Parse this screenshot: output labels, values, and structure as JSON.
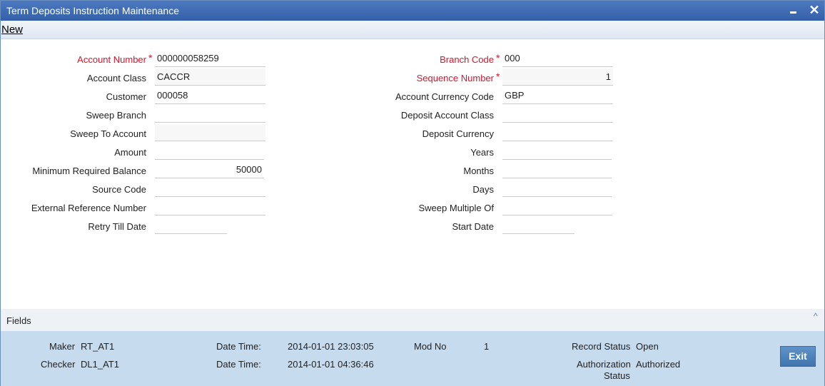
{
  "window": {
    "title": "Term Deposits Instruction Maintenance",
    "minimize": "",
    "close": "✕"
  },
  "menu": {
    "new_label": "New"
  },
  "left_form": {
    "account_number": {
      "label": "Account Number",
      "value": "000000058259"
    },
    "account_class": {
      "label": "Account Class",
      "value": "CACCR"
    },
    "customer": {
      "label": "Customer",
      "value": "000058"
    },
    "sweep_branch": {
      "label": "Sweep Branch",
      "value": ""
    },
    "sweep_to_account": {
      "label": "Sweep To Account",
      "value": ""
    },
    "amount": {
      "label": "Amount",
      "value": ""
    },
    "min_required_balance": {
      "label": "Minimum Required Balance",
      "value": "50000"
    },
    "source_code": {
      "label": "Source Code",
      "value": ""
    },
    "external_reference_number": {
      "label": "External Reference Number",
      "value": ""
    },
    "retry_till_date": {
      "label": "Retry Till Date",
      "value": ""
    }
  },
  "right_form": {
    "branch_code": {
      "label": "Branch Code",
      "value": "000"
    },
    "sequence_number": {
      "label": "Sequence Number",
      "value": "1"
    },
    "account_currency_code": {
      "label": "Account Currency Code",
      "value": "GBP"
    },
    "deposit_account_class": {
      "label": "Deposit Account Class",
      "value": ""
    },
    "deposit_currency": {
      "label": "Deposit Currency",
      "value": ""
    },
    "years": {
      "label": "Years",
      "value": ""
    },
    "months": {
      "label": "Months",
      "value": ""
    },
    "days": {
      "label": "Days",
      "value": ""
    },
    "sweep_multiple_of": {
      "label": "Sweep Multiple Of",
      "value": ""
    },
    "start_date": {
      "label": "Start Date",
      "value": ""
    }
  },
  "required_marker": "*",
  "fields_section": {
    "label": "Fields",
    "toggle": "^"
  },
  "footer": {
    "maker_label": "Maker",
    "maker_value": "RT_AT1",
    "checker_label": "Checker",
    "checker_value": "DL1_AT1",
    "maker_datetime_label": "Date Time:",
    "maker_datetime_value": "2014-01-01 23:03:05",
    "checker_datetime_label": "Date Time:",
    "checker_datetime_value": "2014-01-01 04:36:46",
    "mod_no_label": "Mod No",
    "mod_no_value": "1",
    "record_status_label": "Record Status",
    "record_status_value": "Open",
    "auth_status_label_1": "Authorization",
    "auth_status_label_2": "Status",
    "auth_status_value": "Authorized",
    "exit_label": "Exit"
  }
}
